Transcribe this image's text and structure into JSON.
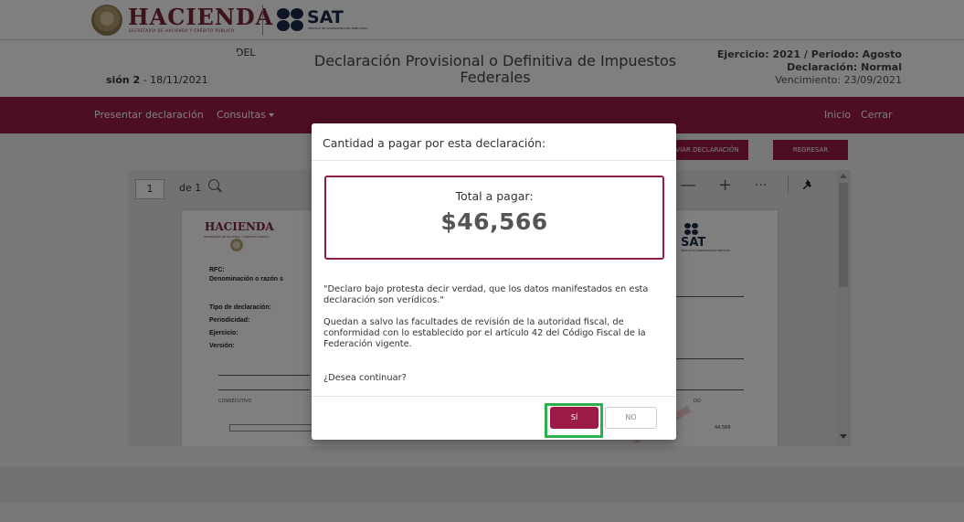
{
  "logos": {
    "hacienda": "HACIENDA",
    "hacienda_sub": "SECRETARÍA DE HACIENDA Y CRÉDITO PÚBLICO",
    "sat": "SAT",
    "sat_sub": "SERVICIO DE ADMINISTRACIÓN TRIBUTARIA"
  },
  "header": {
    "left_line1": "DEL",
    "left_line2_bold": "sión 2",
    "left_line2_date": " - 18/11/2021",
    "title": "Declaración Provisional o Definitiva de Impuestos Federales",
    "ejercicio": "Ejercicio: 2021 / Periodo: Agosto",
    "declaracion": "Declaración: Normal",
    "vencimiento": "Vencimiento: 23/09/2021"
  },
  "nav": {
    "presentar": "Presentar declaración",
    "consultas": "Consultas",
    "inicio": "Inicio",
    "cerrar": "Cerrar"
  },
  "toolbar": {
    "enviar_label": "VIAR DECLARACIÓN",
    "regresar_label": "REGRESAR"
  },
  "viewer": {
    "page_number": "1",
    "page_of": "de 1",
    "zoom_out": "—",
    "zoom_in": "+",
    "more": "···"
  },
  "doc": {
    "hacienda": "HACIENDA",
    "hacienda_sub": "SECRETARÍA DE HACIENDA Y CRÉDITO PÚBLICO",
    "sat": "SAT",
    "sat_sub": "SERVICIO DE ADMINISTRACIÓN TRIBUTARIA",
    "rfc": "RFC:",
    "denominacion": "Denominación o razón s",
    "tipo": "Tipo de declaración:",
    "periodicidad": "Periodicidad:",
    "ejercicio": "Ejercicio:",
    "version": "Versión:",
    "consecutivo": "CONSECUTIVO",
    "col_right": "DO",
    "amount": "44,566"
  },
  "modal": {
    "title": "Cantidad a pagar por esta declaración:",
    "total_label": "Total a pagar:",
    "total_amount": "$46,566",
    "p1": "\"Declaro bajo protesta decir verdad, que los datos manifestados en esta declaración son verídicos.\"",
    "p2": "Quedan a salvo las facultades de revisión de la autoridad fiscal, de conformidad con lo establecido por el artículo 42 del Código Fiscal de la Federación vigente.",
    "p3": "¿Desea continuar?",
    "yes_label": "SÍ",
    "no_label": "NO"
  },
  "colors": {
    "brand": "#9b1b46",
    "highlight": "#2db24b"
  }
}
